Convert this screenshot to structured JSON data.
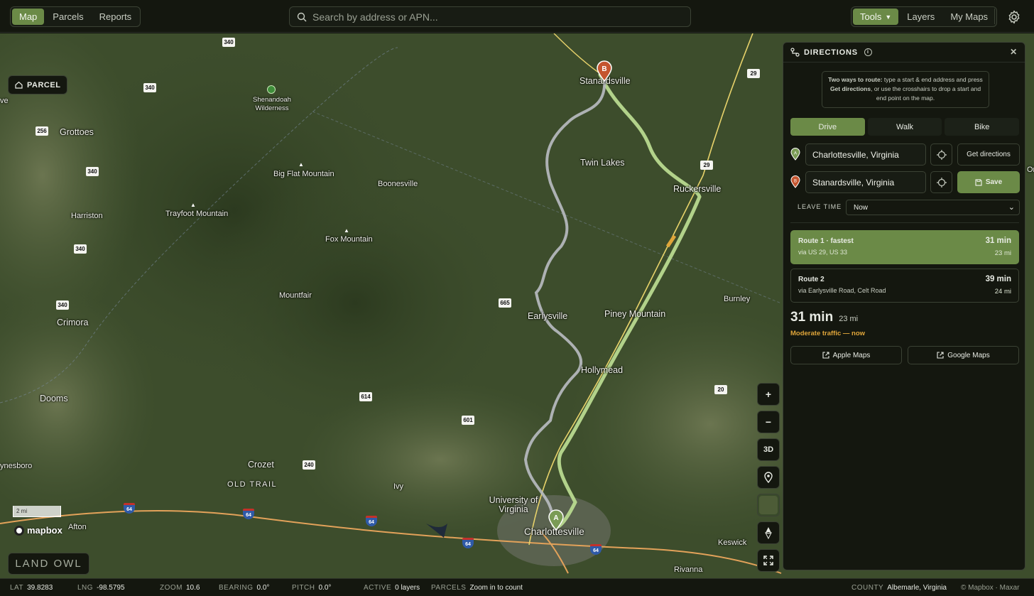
{
  "nav": {
    "items": [
      "Map",
      "Parcels",
      "Reports"
    ],
    "active": "Map"
  },
  "search": {
    "placeholder": "Search by address or APN..."
  },
  "tools": {
    "items": [
      "Tools",
      "Layers",
      "My Maps"
    ],
    "active": "Tools"
  },
  "map": {
    "parcel_chip": "PARCEL",
    "scale_label": "2 mi",
    "attribution_logo": "mapbox",
    "brand_logo": "LAND OWL",
    "places": [
      {
        "name": "Stanardsville"
      },
      {
        "name": "Twin Lakes"
      },
      {
        "name": "Ruckersville"
      },
      {
        "name": "Boonesville"
      },
      {
        "name": "Big Flat Mountain"
      },
      {
        "name": "Trayfoot Mountain"
      },
      {
        "name": "Fox Mountain"
      },
      {
        "name": "Mountfair"
      },
      {
        "name": "Earlysville"
      },
      {
        "name": "Piney Mountain"
      },
      {
        "name": "Hollymead"
      },
      {
        "name": "Burnley"
      },
      {
        "name": "Grottoes"
      },
      {
        "name": "Harriston"
      },
      {
        "name": "Crimora"
      },
      {
        "name": "Dooms"
      },
      {
        "name": "Crozet"
      },
      {
        "name": "OLD TRAIL"
      },
      {
        "name": "Ivy"
      },
      {
        "name": "University of Virginia"
      },
      {
        "name": "Charlottesville"
      },
      {
        "name": "Afton"
      },
      {
        "name": "Keswick"
      },
      {
        "name": "Rivanna"
      },
      {
        "name": "ynesboro"
      },
      {
        "name": "Shenandoah Wilderness"
      },
      {
        "name": "ve"
      },
      {
        "name": "Or"
      }
    ],
    "shields": [
      "340",
      "340",
      "256",
      "340",
      "340",
      "340",
      "29",
      "29",
      "665",
      "614",
      "601",
      "240",
      "20",
      "64",
      "64",
      "64",
      "64",
      "64"
    ],
    "controls": [
      "+",
      "−",
      "3D"
    ]
  },
  "directions": {
    "title": "DIRECTIONS",
    "hint_bold1": "Two ways to route:",
    "hint_text1": " type a start & end address and press ",
    "hint_bold2": "Get directions",
    "hint_text2": ", or use the crosshairs to drop a start and end point on the map.",
    "modes": [
      "Drive",
      "Walk",
      "Bike"
    ],
    "active_mode": "Drive",
    "start": "Charlottesville, Virginia",
    "end": "Stanardsville, Virginia",
    "get_directions": "Get directions",
    "save": "Save",
    "leave_time_label": "LEAVE TIME",
    "leave_time_value": "Now",
    "routes": [
      {
        "name": "Route 1 · fastest",
        "via": "via US 29, US 33",
        "time": "31 min",
        "distance": "23 mi"
      },
      {
        "name": "Route 2",
        "via": "via Earlysville Road, Celt Road",
        "time": "39 min",
        "distance": "24 mi"
      }
    ],
    "summary_time": "31 min",
    "summary_distance": "23 mi",
    "traffic": "Moderate traffic — now",
    "apple_maps": "Apple Maps",
    "google_maps": "Google Maps",
    "colors": {
      "accent": "#6b8a47",
      "route_main": "#b8d98f",
      "route_alt": "#b9bcc2",
      "pin_a": "#7a9b55",
      "pin_b": "#c4552f",
      "traffic": "#e0a63a"
    }
  },
  "status": {
    "lat_label": "LAT",
    "lat": "39.8283",
    "lng_label": "LNG",
    "lng": "-98.5795",
    "zoom_label": "ZOOM",
    "zoom": "10.6",
    "bearing_label": "BEARING",
    "bearing": "0.0°",
    "pitch_label": "PITCH",
    "pitch": "0.0°",
    "active_label": "ACTIVE",
    "active": "0 layers",
    "parcels_label": "PARCELS",
    "parcels": "Zoom in to count",
    "county_label": "COUNTY",
    "county": "Albemarle, Virginia",
    "copyright": "© Mapbox · Maxar"
  }
}
